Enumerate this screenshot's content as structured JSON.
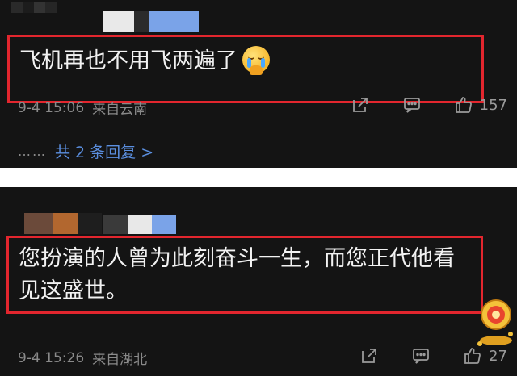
{
  "colors": {
    "background": "#141414",
    "highlight_border": "#e3262e",
    "link": "#5b8fe0",
    "meta_text": "#8a8a8a"
  },
  "comments": [
    {
      "text": "飞机再也不用飞两遍了",
      "emoji": "crying-face-emoji",
      "timestamp": "9-4 15:06",
      "location": "来自云南",
      "likes": "157",
      "replies_dots": "……",
      "replies_link": "共 2 条回复 >"
    },
    {
      "text": "您扮演的人曾为此刻奋斗一生，而您正代他看见这盛世。",
      "timestamp": "9-4 15:26",
      "location": "来自湖北",
      "likes": "27"
    }
  ],
  "icons": [
    "share-icon",
    "comment-icon",
    "like-icon"
  ]
}
